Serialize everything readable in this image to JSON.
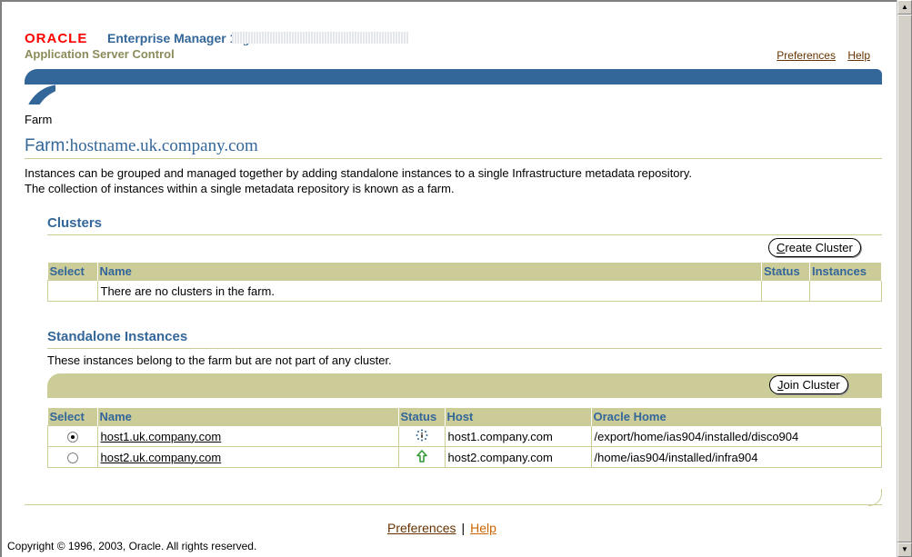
{
  "header": {
    "oracle": "ORACLE",
    "product": "Enterprise Manager 10",
    "product_suffix": "g",
    "subtitle": "Application Server Control",
    "links": [
      "Preferences",
      "Help"
    ]
  },
  "breadcrumb": "Farm",
  "page": {
    "title_prefix": "Farm:",
    "title_host": "hostname.uk.company.com",
    "intro_line1": "Instances can be grouped and managed together by adding standalone instances to a single Infrastructure metadata repository.",
    "intro_line2": "The collection of instances within a single metadata repository is known as a farm."
  },
  "clusters": {
    "title": "Clusters",
    "create_button": "Create Cluster",
    "create_button_mnemonic": "C",
    "columns": [
      "Select",
      "Name",
      "Status",
      "Instances"
    ],
    "empty_message": "There are no clusters in the farm."
  },
  "standalone": {
    "title": "Standalone Instances",
    "description": "These instances belong to the farm but are not part of any cluster.",
    "join_button": "Join Cluster",
    "join_button_mnemonic": "J",
    "columns": [
      "Select",
      "Name",
      "Status",
      "Host",
      "Oracle Home"
    ],
    "rows": [
      {
        "selected": true,
        "name": "host1.uk.company.com",
        "status": "unknown-icon",
        "host": "host1.company.com",
        "oracle_home": "/export/home/ias904/installed/disco904"
      },
      {
        "selected": false,
        "name": "host2.uk.company.com",
        "status": "up-arrow-icon",
        "host": "host2.company.com",
        "oracle_home": "/home/ias904/installed/infra904"
      }
    ]
  },
  "footer": {
    "links": [
      "Preferences",
      "Help"
    ],
    "separator": "|",
    "copyright": "Copyright © 1996, 2003, Oracle. All rights reserved."
  },
  "colors": {
    "brand_blue": "#336699",
    "table_header": "#cccc99",
    "oracle_red": "#ff0000",
    "status_up": "#339933"
  }
}
